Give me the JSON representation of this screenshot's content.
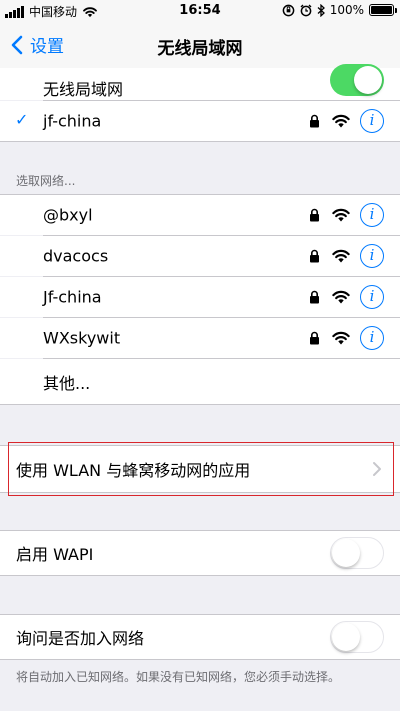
{
  "status_bar": {
    "carrier": "中国移动",
    "time": "16:54",
    "battery": "100%"
  },
  "nav": {
    "back_label": "设置",
    "title": "无线局域网"
  },
  "wlan_toggle": {
    "label": "无线局域网",
    "on": true
  },
  "connected_network": {
    "name": "jf-china"
  },
  "choose_network": {
    "header": "选取网络...",
    "networks": [
      {
        "name": "@bxyl"
      },
      {
        "name": "dvacocs"
      },
      {
        "name": "Jf-china"
      },
      {
        "name": "WXskywit"
      }
    ],
    "other_label": "其他..."
  },
  "apps_using_wlan": {
    "label": "使用 WLAN 与蜂窝移动网的应用"
  },
  "wapi": {
    "label": "启用 WAPI",
    "on": false
  },
  "ask_to_join": {
    "label": "询问是否加入网络",
    "on": false,
    "footer": "将自动加入已知网络。如果没有已知网络，您必须手动选择。"
  },
  "colors": {
    "accent": "#007aff",
    "toggle_on": "#4cd964",
    "highlight_border": "#d9262c"
  }
}
